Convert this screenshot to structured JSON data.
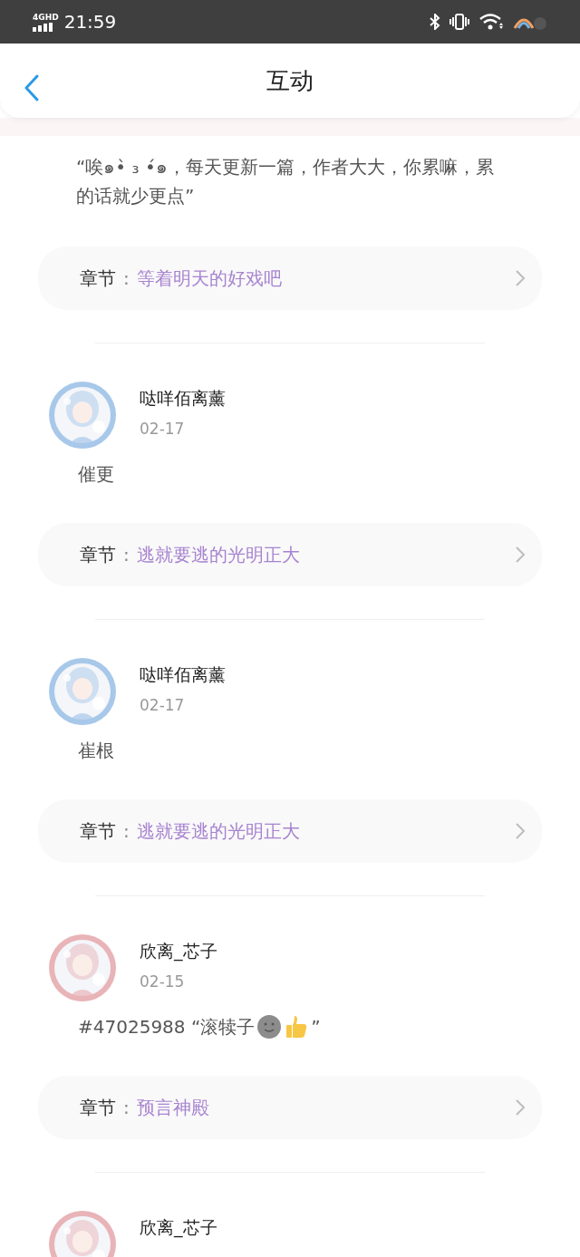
{
  "status_bar": {
    "network": "4G",
    "network_sub": "HD",
    "time": "21:59"
  },
  "header": {
    "title": "互动"
  },
  "posts": [
    {
      "kind": "continued",
      "comment": "“唉๑•̀ ₃ •́๑，每天更新一篇，作者大大，你累嘛，累的话就少更点”",
      "chapter_label": "章节",
      "chapter_colon": ":",
      "chapter": "等着明天的好戏吧"
    },
    {
      "kind": "full",
      "user": "哒咩佰离薰",
      "date": "02-17",
      "comment": "催更",
      "chapter_label": "章节",
      "chapter_colon": ":",
      "chapter": "逃就要逃的光明正大"
    },
    {
      "kind": "full",
      "user": "哒咩佰离薰",
      "date": "02-17",
      "comment": "崔根",
      "chapter_label": "章节",
      "chapter_colon": ":",
      "chapter": "逃就要逃的光明正大"
    },
    {
      "kind": "full",
      "user": "欣离_芯子",
      "date": "02-15",
      "comment": "#47025988 “滚犊子",
      "emojis": [
        {
          "kind": "smiley"
        },
        {
          "kind": "thumbs-up"
        }
      ],
      "comment_end": "”",
      "chapter_label": "章节",
      "chapter_colon": ":",
      "chapter": "预言神殿"
    },
    {
      "kind": "cut",
      "user": "欣离_芯子"
    }
  ]
}
